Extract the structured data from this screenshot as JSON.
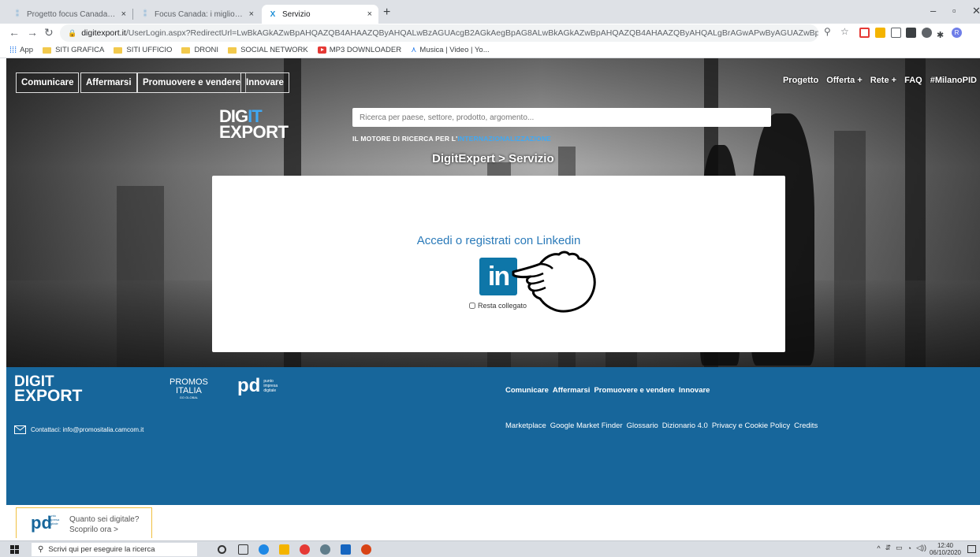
{
  "browser": {
    "tabs": [
      {
        "title": "Progetto focus Canada/Russia: fo",
        "active": false
      },
      {
        "title": "Focus Canada: i migliori marketp",
        "active": false
      },
      {
        "title": "Servizio",
        "active": true
      }
    ],
    "new_tab": "+",
    "tab_close": "×",
    "window_controls": {
      "minimize": "–",
      "maximize": "▫",
      "close": "✕"
    },
    "url_host": "digitexport.it",
    "url_path": "/UserLogin.aspx?RedirectUrl=LwBkAGkAZwBpAHQAZQB4AHAAZQByAHQALwBzAGUAcgB2AGkAegBpAG8ALwBkAGkAZwBpAHQAZQB4AHAAZQByAHQALgBrAGwAPwByAGUAZwBpAHMAdABlAHIAPQByAGUAcQA_#/",
    "bookmarks": [
      {
        "label": "App",
        "icon": "apps-grid-icon"
      },
      {
        "label": "SITI GRAFICA",
        "icon": "folder-icon"
      },
      {
        "label": "SITI UFFICIO",
        "icon": "folder-icon"
      },
      {
        "label": "DRONI",
        "icon": "folder-icon"
      },
      {
        "label": "SOCIAL NETWORK",
        "icon": "folder-icon"
      },
      {
        "label": "MP3 DOWNLOADER",
        "icon": "youtube-icon"
      },
      {
        "label": "Musica | Video | Yo...",
        "icon": "music-icon"
      }
    ]
  },
  "site": {
    "categories": [
      "Comunicare",
      "Affermarsi",
      "Promuovere e vendere",
      "Innovare"
    ],
    "topnav": [
      "Progetto",
      "Offerta +",
      "Rete +",
      "FAQ",
      "#MilanoPID"
    ],
    "logo": {
      "line1_a": "DIG",
      "line1_b": "IT",
      "line2": "EXPORT"
    },
    "search_placeholder": "Ricerca per paese, settore, prodotto, argomento...",
    "motore_text": "IL MOTORE DI RICERCA PER L'",
    "motore_accent": "INTERNAZIONALIZZAZIONE",
    "breadcrumb": "DigitExpert > Servizio",
    "login": {
      "title": "Accedi o registrati con Linkedin",
      "linkedin_label": "in",
      "remember": "Resta collegato"
    },
    "footer": {
      "logo_line1": "DIGIT",
      "logo_line2": "EXPORT",
      "promos": "PROMOS",
      "promos2": "ITALIA",
      "promos_small": "GO GLOBAL",
      "pid_mark": "pd",
      "pid_text": [
        "punto",
        "impresa",
        "digitale"
      ],
      "contact": "Contattaci: info@promositalia.camcom.it",
      "links_primary": [
        "Comunicare",
        "Affermarsi",
        "Promuovere e vendere",
        "Innovare"
      ],
      "links_secondary": [
        "Marketplace",
        "Google Market Finder",
        "Glossario",
        "Dizionario 4.0",
        "Privacy e Cookie Policy",
        "Credits"
      ]
    },
    "promo_box": {
      "mark": "pd",
      "mark_text": [
        "punto",
        "impresa",
        "digitale"
      ],
      "line1": "Quanto sei digitale?",
      "line2": "Scoprilo ora >"
    }
  },
  "taskbar": {
    "search_placeholder": "Scrivi qui per eseguire la ricerca",
    "time": "12:40",
    "date": "06/10/2020"
  },
  "colors": {
    "brand_blue": "#17669b",
    "linkedin": "#0e76a8",
    "title_blue": "#2a7ab9",
    "accent": "#3fa9f5"
  }
}
